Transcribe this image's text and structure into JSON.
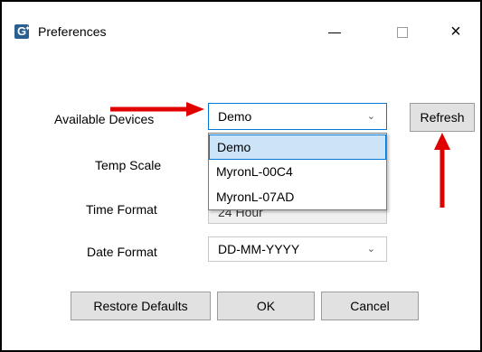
{
  "window": {
    "title": "Preferences",
    "app_icon_letter": "G",
    "controls": {
      "minimize": "minimize",
      "maximize": "maximize",
      "close": "×"
    }
  },
  "form": {
    "available_devices": {
      "label": "Available Devices",
      "value": "Demo"
    },
    "temp_scale": {
      "label": "Temp Scale"
    },
    "time_format": {
      "label": "Time Format",
      "value": "24 Hour"
    },
    "date_format": {
      "label": "Date Format",
      "value": "DD-MM-YYYY"
    }
  },
  "dropdown_options": [
    "Demo",
    "MyronL-00C4",
    "MyronL-07AD"
  ],
  "buttons": {
    "refresh": "Refresh",
    "restore_defaults": "Restore Defaults",
    "ok": "OK",
    "cancel": "Cancel"
  },
  "colors": {
    "annotation_arrow": "#e10000",
    "selection": "#cce4f7",
    "selection_border": "#0078d7"
  }
}
